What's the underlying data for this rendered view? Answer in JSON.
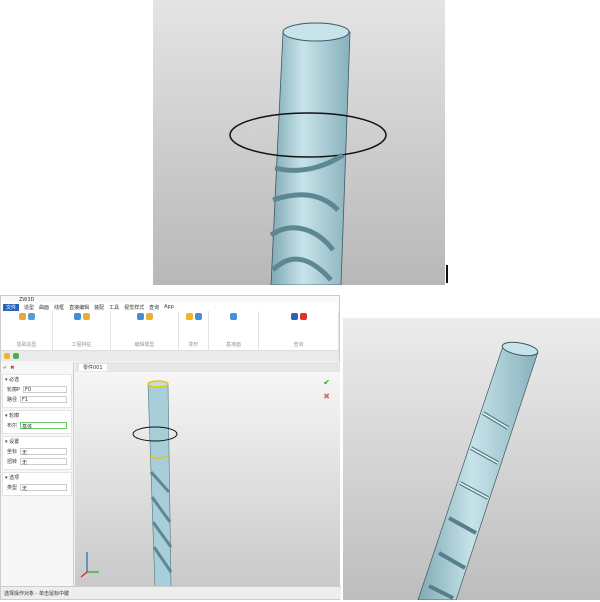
{
  "app": {
    "title": "ZW3D",
    "file_tab": "零件001"
  },
  "menu": [
    "文件",
    "造型",
    "曲面",
    "线框",
    "直接编辑",
    "装配",
    "工具",
    "视觉样式",
    "查询",
    "App"
  ],
  "ribbon_groups": [
    "基础造型",
    "工程特征",
    "编辑模型",
    "变形",
    "基准面",
    "查询"
  ],
  "panel": {
    "sections": [
      "必选",
      "轮廓",
      "设置",
      "选项"
    ],
    "fields": [
      {
        "label": "轮廓P",
        "value": "F0"
      },
      {
        "label": "路径",
        "value": "F1"
      },
      {
        "label": "布尔",
        "value": "基体"
      },
      {
        "label": "坐标",
        "value": "无"
      },
      {
        "label": "扭转",
        "value": "无"
      },
      {
        "label": "类型",
        "value": "无"
      }
    ]
  },
  "status": "选择操作对象 - 单击鼠标中键",
  "colors": {
    "accent": "#2b63b8",
    "tool": "#a8cfd9",
    "ring": "#f2c200"
  }
}
